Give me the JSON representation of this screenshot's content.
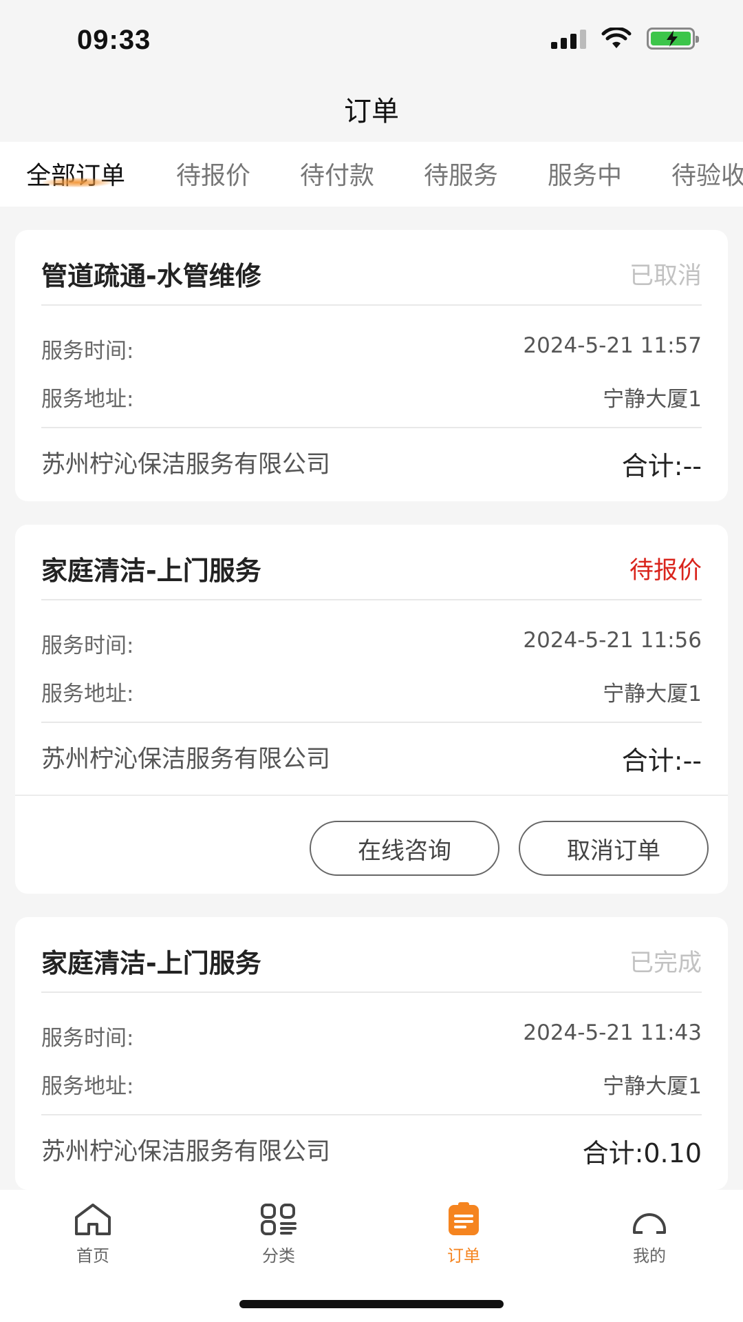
{
  "status_bar": {
    "time": "09:33"
  },
  "header": {
    "title": "订单"
  },
  "tabs": [
    {
      "label": "全部订单"
    },
    {
      "label": "待报价"
    },
    {
      "label": "待付款"
    },
    {
      "label": "待服务"
    },
    {
      "label": "服务中"
    },
    {
      "label": "待验收"
    }
  ],
  "orders": [
    {
      "title": "管道疏通-水管维修",
      "status": "已取消",
      "time_label": "服务时间:",
      "time_value": "2024-5-21 11:57",
      "address_label": "服务地址:",
      "address_value": "宁静大厦1",
      "company": "苏州柠沁保洁服务有限公司",
      "total": "合计:--"
    },
    {
      "title": "家庭清洁-上门服务",
      "status": "待报价",
      "time_label": "服务时间:",
      "time_value": "2024-5-21 11:56",
      "address_label": "服务地址:",
      "address_value": "宁静大厦1",
      "company": "苏州柠沁保洁服务有限公司",
      "total": "合计:--",
      "actions": [
        "在线咨询",
        "取消订单"
      ]
    },
    {
      "title": "家庭清洁-上门服务",
      "status": "已完成",
      "time_label": "服务时间:",
      "time_value": "2024-5-21 11:43",
      "address_label": "服务地址:",
      "address_value": "宁静大厦1",
      "company": "苏州柠沁保洁服务有限公司",
      "total": "合计:0.10"
    }
  ],
  "tabbar": [
    {
      "label": "首页",
      "icon": "home-icon"
    },
    {
      "label": "分类",
      "icon": "category-icon"
    },
    {
      "label": "订单",
      "icon": "order-icon"
    },
    {
      "label": "我的",
      "icon": "profile-icon"
    }
  ],
  "colors": {
    "accent": "#f5841f",
    "status_red": "#d9241c",
    "status_muted": "#c2c2c2"
  }
}
